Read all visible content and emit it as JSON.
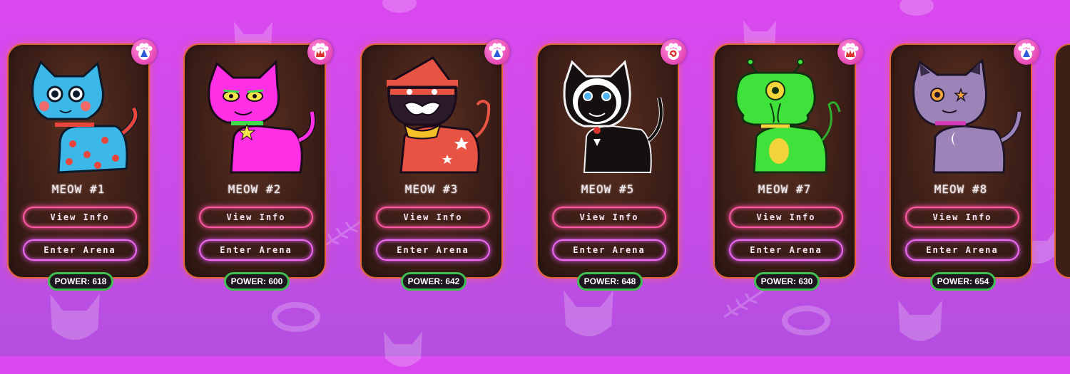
{
  "cards": [
    {
      "title": "MEOW #1",
      "view_label": "View Info",
      "arena_label": "Enter Arena",
      "power": "POWER: 618",
      "badge_icon": "paw-badge-wizard-hat-blue-icon",
      "body_color": "#3cb8e8",
      "spot_color": "#e8453d"
    },
    {
      "title": "MEOW #2",
      "view_label": "View Info",
      "arena_label": "Enter Arena",
      "power": "POWER: 600",
      "badge_icon": "paw-badge-crown-red-icon",
      "body_color": "#ff2fe6",
      "spot_color": "#3fd94c"
    },
    {
      "title": "MEOW #3",
      "view_label": "View Info",
      "arena_label": "Enter Arena",
      "power": "POWER: 642",
      "badge_icon": "paw-badge-wizard-hat-blue-icon",
      "body_color": "#e85443",
      "spot_color": "#f4c12b"
    },
    {
      "title": "MEOW #5",
      "view_label": "View Info",
      "arena_label": "Enter Arena",
      "power": "POWER: 648",
      "badge_icon": "paw-badge-swirl-red-icon",
      "body_color": "#141010",
      "spot_color": "#ffffff"
    },
    {
      "title": "MEOW #7",
      "view_label": "View Info",
      "arena_label": "Enter Arena",
      "power": "POWER: 630",
      "badge_icon": "paw-badge-crown-red-icon",
      "body_color": "#3ee23a",
      "spot_color": "#f4d43b"
    },
    {
      "title": "MEOW #8",
      "view_label": "View Info",
      "arena_label": "Enter Arena",
      "power": "POWER: 654",
      "badge_icon": "paw-badge-wizard-hat-blue-icon",
      "body_color": "#9c84b8",
      "spot_color": "#d43cb8"
    }
  ],
  "colors": {
    "background": "#da48ef",
    "card_border": "#e0663a",
    "view_button_glow": "#ff5aa6",
    "arena_button_glow": "#f06cf5",
    "power_border": "#3fbf52"
  }
}
